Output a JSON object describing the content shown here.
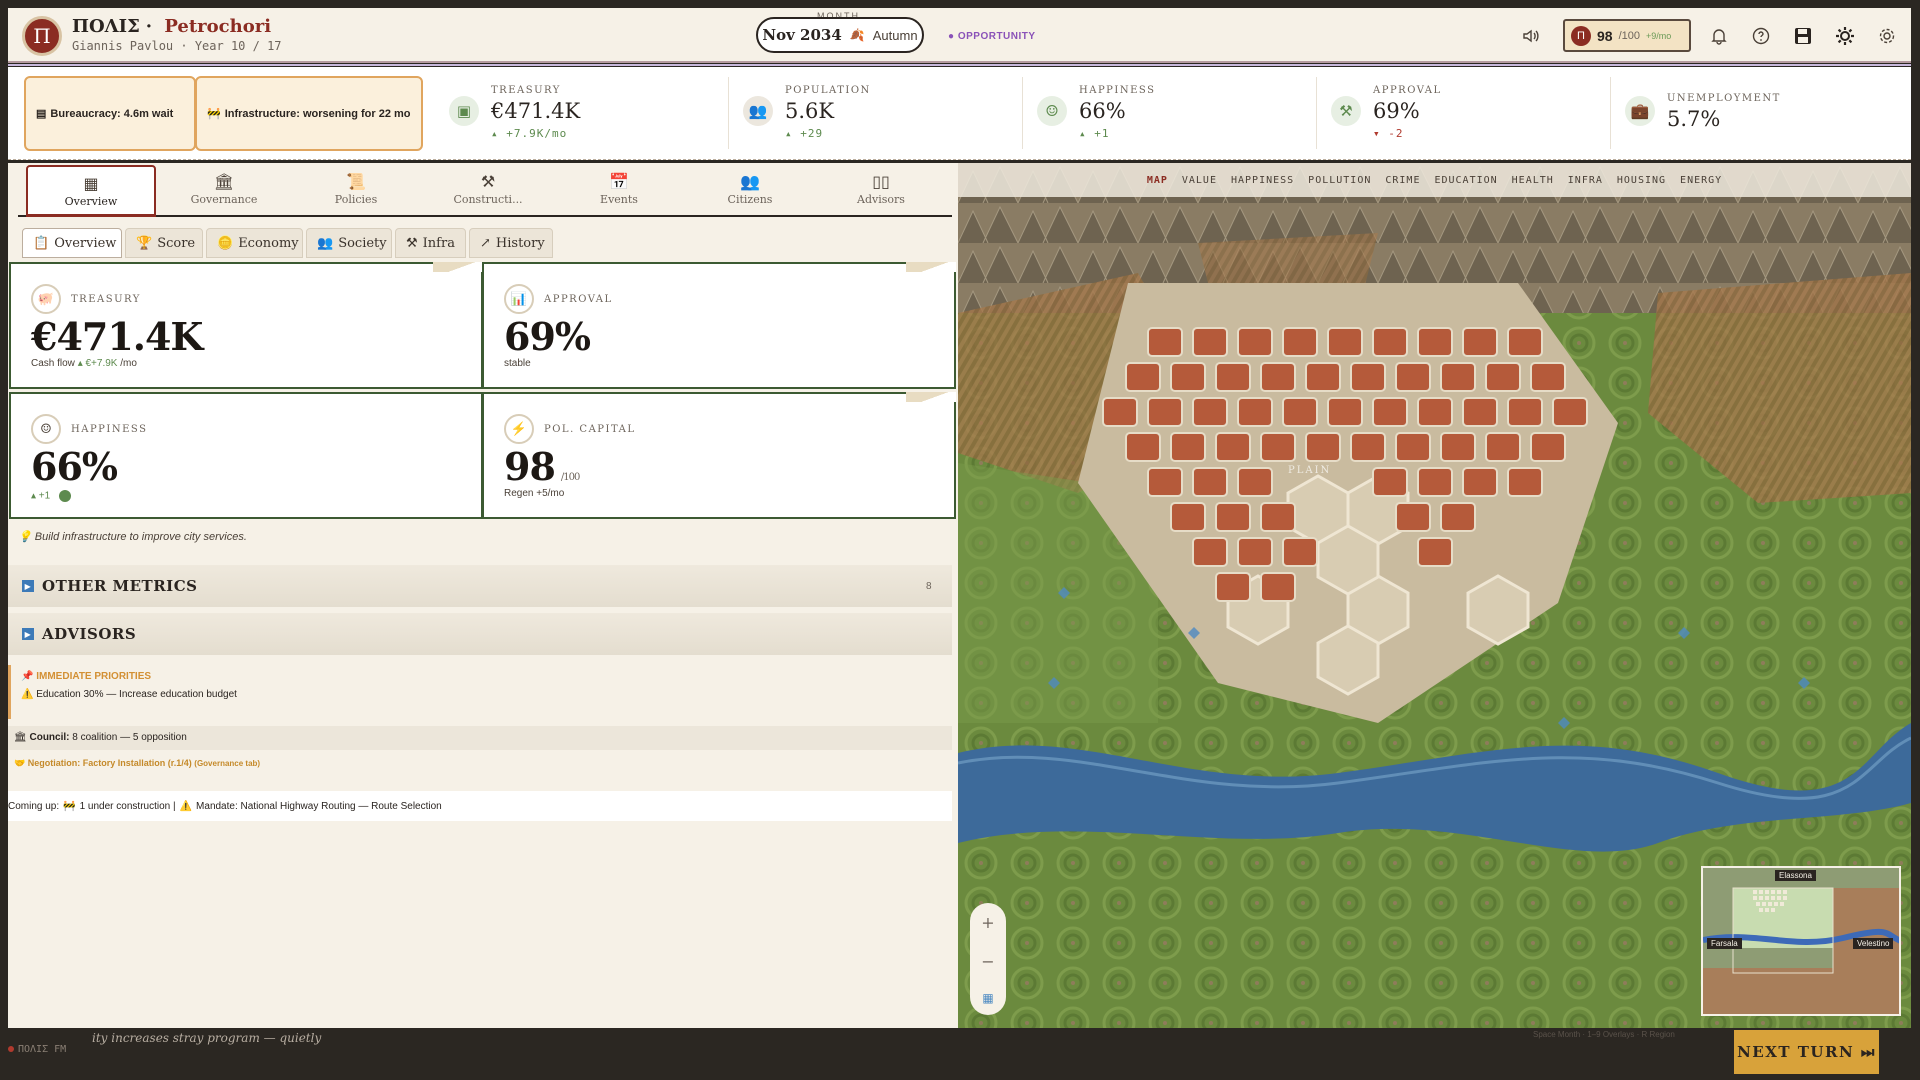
{
  "header": {
    "logo_letter": "Π",
    "game_name": "ΠΟΛΙΣ",
    "city_name": "Petrochori",
    "subtitle": "Giannis Pavlou · Year 10 / 17",
    "month_label": "MONTH",
    "month_date": "Nov 2034",
    "season": "Autumn",
    "opportunity": "OPPORTUNITY",
    "pol_capital": {
      "value": "98",
      "max": "/100",
      "regen": "+9/mo"
    }
  },
  "alerts": [
    {
      "icon": "bureaucracy-icon",
      "text": "Bureaucracy: 4.6m wait"
    },
    {
      "icon": "construction-icon",
      "text": "Infrastructure: worsening for 22 mo"
    }
  ],
  "stats": [
    {
      "label": "TREASURY",
      "value": "€471.4K",
      "delta": "▴ +7.9K/mo",
      "negative": false
    },
    {
      "label": "POPULATION",
      "value": "5.6K",
      "delta": "▴ +29",
      "negative": false
    },
    {
      "label": "HAPPINESS",
      "value": "66%",
      "delta": "▴ +1",
      "negative": false
    },
    {
      "label": "APPROVAL",
      "value": "69%",
      "delta": "▾ -2",
      "negative": true
    },
    {
      "label": "UNEMPLOYMENT",
      "value": "5.7%",
      "delta": "",
      "negative": false
    }
  ],
  "main_tabs": [
    "Overview",
    "Governance",
    "Policies",
    "Constructi...",
    "Events",
    "Citizens",
    "Advisors"
  ],
  "sub_tabs": [
    "Overview",
    "Score",
    "Economy",
    "Society",
    "Infra",
    "History"
  ],
  "cards": {
    "treasury": {
      "label": "TREASURY",
      "value": "€471.4K",
      "sub_label": "Cash flow",
      "sub_delta": "▴ €+7.9K",
      "sub_unit": "/mo"
    },
    "approval": {
      "label": "APPROVAL",
      "value": "69%",
      "sub": "stable"
    },
    "happiness": {
      "label": "HAPPINESS",
      "value": "66%",
      "sub": "▴ +1"
    },
    "pol_capital": {
      "label": "POL. CAPITAL",
      "value": "98",
      "unit": "/100",
      "sub": "Regen +5/mo"
    }
  },
  "tip": "Build infrastructure to improve city services.",
  "sections": {
    "other_metrics": {
      "title": "OTHER METRICS",
      "count": "8"
    },
    "advisors": {
      "title": "ADVISORS"
    }
  },
  "priorities": {
    "title": "IMMEDIATE PRIORITIES",
    "item": "Education 30% — Increase education budget"
  },
  "council": {
    "label": "Council:",
    "text": "8 coalition — 5 opposition"
  },
  "negotiation": {
    "text": "Negotiation: Factory Installation (r.1/4)",
    "note": "(Governance tab)"
  },
  "coming_up": {
    "prefix": "Coming up:",
    "construction": "1 under construction |",
    "mandate": "Mandate: National Highway Routing — Route Selection"
  },
  "map": {
    "overlays": [
      "MAP",
      "VALUE",
      "HAPPINESS",
      "POLLUTION",
      "CRIME",
      "EDUCATION",
      "HEALTH",
      "INFRA",
      "HOUSING",
      "ENERGY"
    ],
    "active_overlay": "MAP",
    "terrain_label": "PLAIN",
    "minimap_labels": [
      "Elassona",
      "Farsala",
      "Velestino"
    ]
  },
  "footer": {
    "radio": "ΠΟΛΙΣ FM",
    "ticker": "ity increases stray program — quietly",
    "shortcuts": "Space Month · 1–9 Overlays · R Region",
    "next_turn": "NEXT TURN ⏭"
  },
  "colors": {
    "accent": "#8b2c22",
    "positive": "#5d8a4e",
    "negative": "#b03a2e",
    "alert_border": "#e0a55e",
    "card_border": "#3c5a32"
  }
}
